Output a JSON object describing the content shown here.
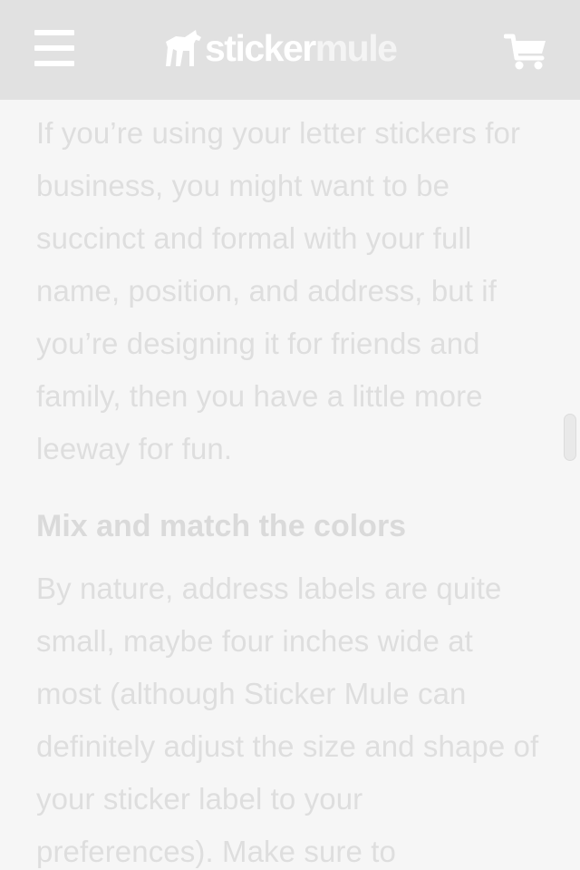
{
  "header": {
    "logo_text_primary": "sticker",
    "logo_text_secondary": "mule",
    "menu_icon": "hamburger-menu-icon",
    "cart_icon": "shopping-cart-icon",
    "logo_icon": "mule-logo-icon",
    "background_color": "#e1e1e1"
  },
  "article": {
    "paragraph_1": "If you’re using your letter stickers for business, you might want to be succinct and formal with your full name, position, and address, but if you’re designing it for friends and family, then you have a little more leeway for fun.",
    "heading_1": "Mix and match the colors",
    "paragraph_2": "By nature, address labels are quite small, maybe four inches wide at most (although Sticker Mule can definitely adjust the size and shape of your sticker label to your preferences). Make sure to"
  },
  "colors": {
    "text": "#dedede",
    "page_background": "#f6f6f6"
  }
}
